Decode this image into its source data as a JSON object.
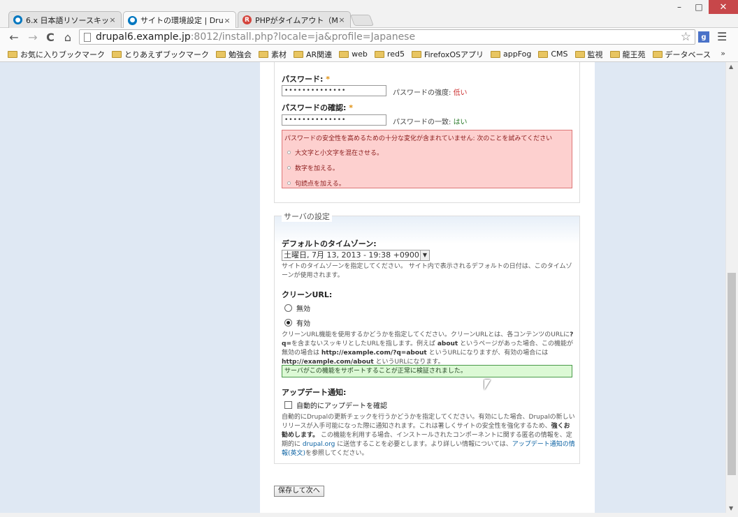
{
  "window": {
    "minimize": "–",
    "maximize": "□",
    "close": "✕"
  },
  "tabs": [
    {
      "label": "6.x 日本語リソースキット | s",
      "icon": "drupal-icon"
    },
    {
      "label": "サイトの環境設定 | Drupal",
      "icon": "drupal-icon"
    },
    {
      "label": "PHPがタイムアウト（Maxim",
      "icon": "r-icon"
    }
  ],
  "tab_close": "×",
  "toolbar": {
    "url_host": "drupal6.example.jp",
    "url_rest": ":8012/install.php?locale=ja&profile=Japanese",
    "star": "☆",
    "ext": "g",
    "menu": "☰",
    "back": "←",
    "forward": "→",
    "reload": "C",
    "home": "⌂"
  },
  "bookmarks": [
    "お気に入りブックマーク",
    "とりあえずブックマーク",
    "勉強会",
    "素材",
    "AR関連",
    "web",
    "red5",
    "FirefoxOSアプリ",
    "appFog",
    "CMS",
    "監視",
    "龍王苑",
    "データベース"
  ],
  "bookmarks_more": "»",
  "form": {
    "password_label": "パスワード:",
    "required_mark": "*",
    "password_value": "••••••••••••••",
    "strength_label": "パスワードの強度:",
    "strength_value": "低い",
    "confirm_label": "パスワードの確認:",
    "confirm_value": "••••••••••••••",
    "match_label": "パスワードの一致:",
    "match_value": "はい",
    "error_message": "パスワードの安全性を高めるための十分な変化が含まれていません: 次のことを試みてください",
    "error_items": [
      "大文字と小文字を混在させる。",
      "数字を加える。",
      "句読点を加える。"
    ],
    "server_legend": "サーバの設定",
    "timezone_label": "デフォルトのタイムゾーン:",
    "timezone_value": "土曜日, 7月 13, 2013 - 19:38 +0900",
    "timezone_desc": "サイトのタイムゾーンを指定してください。 サイト内で表示されるデフォルトの日付は、このタイムゾーンが使用されます。",
    "clean_url_label": "クリーンURL:",
    "clean_url_off": "無効",
    "clean_url_on": "有効",
    "clean_url_desc_1": "クリーンURL機能を使用するかどうかを指定してください。クリーンURLとは、各コンテンツのURLに",
    "clean_url_desc_q": "?q=",
    "clean_url_desc_2": "を含まないスッキリとしたURLを指します。例えば",
    "clean_url_desc_about": "about",
    "clean_url_desc_3": "というページがあった場合、この機能が無効の場合は",
    "clean_url_desc_url1": "http://example.com/?q=about",
    "clean_url_desc_4": "というURLになりますが、有効の場合には",
    "clean_url_desc_url2": "http://example.com/about",
    "clean_url_desc_5": "というURLになります。",
    "clean_url_ok": "サーバがこの機能をサポートすることが正常に検証されました。",
    "update_label": "アップデート通知:",
    "update_checkbox": "自動的にアップデートを確認",
    "update_desc_1": "自動的にDrupalの更新チェックを行うかどうかを指定してください。有効にした場合、Drupalの新しいリリースが入手可能になった際に通知されます。これは著しくサイトの安全性を強化するため、",
    "update_desc_strong": "強くお勧めします。",
    "update_desc_2": "この機能を利用する場合、インストールされたコンポーネントに関する匿名の情報を、定期的に",
    "update_desc_link1": "drupal.org",
    "update_desc_3": "に送信することを必要とします。より詳しい情報については、",
    "update_desc_link2": "アップデート通知の情報(英文)",
    "update_desc_4": "を参照してください。",
    "submit_label": "保存して次へ"
  }
}
